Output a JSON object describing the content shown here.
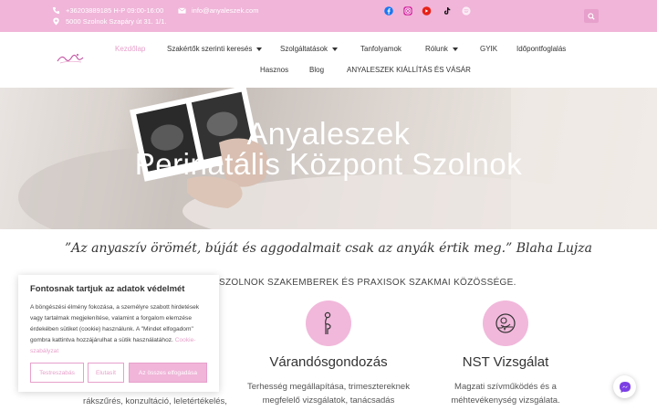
{
  "topbar": {
    "phone": "+36203889185 H-P 09:00-16:00",
    "address": "5000 Szolnok Szapáry út 31. 1/1.",
    "email": "info@anyaleszek.com"
  },
  "nav": {
    "row1": [
      "Kezdőlap",
      "Szakértők szerinti keresés",
      "Szolgáltatások",
      "Tanfolyamok",
      "Rólunk",
      "GYIK",
      "Időpontfoglalás"
    ],
    "row2": [
      "Hasznos",
      "Blog",
      "ANYALESZEK KIÁLLÍTÁS ÉS VÁSÁR"
    ]
  },
  "hero": {
    "title_line1": "Anyaleszek",
    "title_line2": "Perinatális Központ Szolnok"
  },
  "quote": "”Az anyaszív örömét, búját és aggodalmait csak az anyák értik meg.” Blaha Lujza",
  "subline": "TÁLIS KÖZPONT SZOLNOK SZAKEMBEREK ÉS PRAXISOK SZAKMAI KÖZÖSSÉGE.",
  "services": [
    {
      "title": "",
      "text": "rákszűrés, konzultáció, leletértékelés,"
    },
    {
      "title": "Várandósgondozás",
      "text": "Terhesség megállapítása, trimesztereknek megfelelő vizsgálatok, tanácsadás"
    },
    {
      "title": "NST Vizsgálat",
      "text": "Magzati szívműködés és a méhtevékenység vizsgálata."
    }
  ],
  "cookie": {
    "title": "Fontosnak tartjuk az adatok védelmét",
    "body": "A böngészési élmény fokozása, a személyre szabott hirdetések vagy tartalmak megjelenítése, valamint a forgalom elemzése érdekében sütiket (cookie) használunk. A \"Mindet elfogadom\" gombra kattintva hozzájárulhat a sütik használatához.",
    "policy_link": "Cookie-szabályzat",
    "btn_customize": "Testreszabás",
    "btn_reject": "Elutasít",
    "btn_accept": "Az összes elfogadása"
  },
  "colors": {
    "accent": "#e7a0cb",
    "topbar": "#f0b5d9"
  }
}
